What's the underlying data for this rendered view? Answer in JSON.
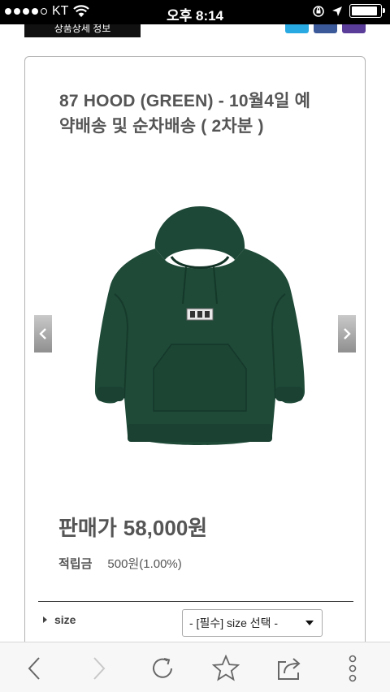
{
  "status_bar": {
    "carrier": "KT",
    "time": "오후 8:14",
    "signal_bars": 4,
    "battery_level": 0.82
  },
  "header": {
    "partial_button_text": "상품상세 정보",
    "share_icons": [
      "twitter-icon",
      "facebook-icon",
      "kakaostory-icon"
    ]
  },
  "product": {
    "title_line1": "87 HOOD (GREEN) - 10월4일 예",
    "title_line2": "약배송 및 순차배송 ( 2차분 )",
    "image_color": "#1f4a38",
    "price_label": "판매가",
    "price_value": "58,000원",
    "points_label": "적립금",
    "points_value": "500원(1.00%)"
  },
  "options": {
    "size_label": "size",
    "size_select_value": "- [필수] size 선택 -"
  },
  "toolbar": {
    "icons": [
      "back-icon",
      "forward-icon",
      "reload-icon",
      "bookmark-icon",
      "share-icon",
      "more-icon"
    ]
  },
  "colors": {
    "accent_green": "#1f4a38",
    "twitter": "#29a9e1",
    "facebook": "#3b5998",
    "kakaostory": "#5a3d99"
  }
}
